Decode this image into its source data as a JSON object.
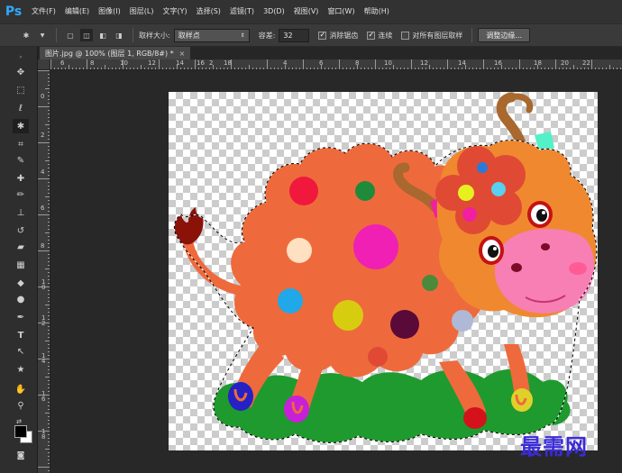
{
  "app": {
    "logo": "Ps"
  },
  "menu": {
    "items": [
      "文件(F)",
      "编辑(E)",
      "图像(I)",
      "图层(L)",
      "文字(Y)",
      "选择(S)",
      "滤镜(T)",
      "3D(D)",
      "视图(V)",
      "窗口(W)",
      "帮助(H)"
    ]
  },
  "options": {
    "sample_size_label": "取样大小:",
    "sample_size_value": "取样点",
    "tolerance_label": "容差:",
    "tolerance_value": "32",
    "antialias_label": "消除锯齿",
    "antialias_checked": true,
    "contiguous_label": "连续",
    "contiguous_checked": true,
    "sample_all_label": "对所有图层取样",
    "sample_all_checked": false,
    "refine_edge_button": "调整边缘..."
  },
  "document": {
    "tab_title": "图片.jpg @ 100% (图层 1, RGB/8#) *",
    "close_label": "×"
  },
  "rulers": {
    "top": [
      "6",
      "8",
      "10",
      "12",
      "14",
      "16",
      "18",
      "2",
      "4",
      "6",
      "8",
      "10",
      "12",
      "14",
      "16",
      "18",
      "20",
      "22"
    ],
    "left": [
      "0",
      "2",
      "4",
      "6",
      "8",
      "1\n0",
      "1\n2",
      "1\n4",
      "1\n6",
      "1\n8"
    ]
  },
  "tools": [
    {
      "name": "move-tool-icon",
      "glyph": "✥"
    },
    {
      "name": "marquee-tool-icon",
      "glyph": "⬚"
    },
    {
      "name": "lasso-tool-icon",
      "glyph": "ℓ"
    },
    {
      "name": "magic-wand-tool-icon",
      "glyph": "✱"
    },
    {
      "name": "crop-tool-icon",
      "glyph": "⌗"
    },
    {
      "name": "eyedropper-tool-icon",
      "glyph": "✎"
    },
    {
      "name": "healing-brush-tool-icon",
      "glyph": "✚"
    },
    {
      "name": "brush-tool-icon",
      "glyph": "✏"
    },
    {
      "name": "clone-stamp-tool-icon",
      "glyph": "⊥"
    },
    {
      "name": "history-brush-tool-icon",
      "glyph": "↺"
    },
    {
      "name": "eraser-tool-icon",
      "glyph": "▰"
    },
    {
      "name": "gradient-tool-icon",
      "glyph": "▦"
    },
    {
      "name": "blur-tool-icon",
      "glyph": "◆"
    },
    {
      "name": "dodge-tool-icon",
      "glyph": "●"
    },
    {
      "name": "pen-tool-icon",
      "glyph": "✒"
    },
    {
      "name": "type-tool-icon",
      "glyph": "T"
    },
    {
      "name": "path-selection-tool-icon",
      "glyph": "↖"
    },
    {
      "name": "shape-tool-icon",
      "glyph": "★"
    },
    {
      "name": "hand-tool-icon",
      "glyph": "✋"
    },
    {
      "name": "zoom-tool-icon",
      "glyph": "⚲"
    }
  ],
  "colors": {
    "foreground": "#000000",
    "background": "#ffffff",
    "accent": "#31a8ff",
    "cow_body": "#ee6a3c",
    "grass": "#1f9a2e",
    "cow_nose": "#f77fb4"
  },
  "watermark": {
    "text": "最需网"
  }
}
